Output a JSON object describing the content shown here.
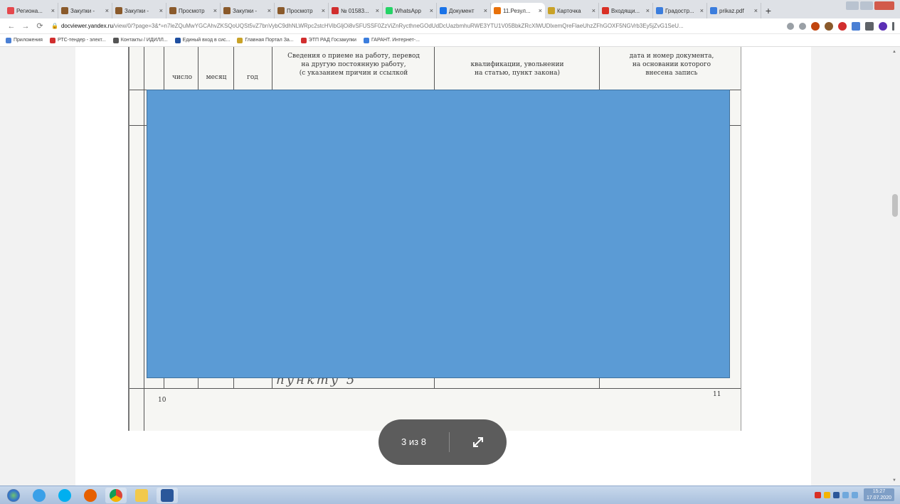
{
  "browser": {
    "tabs": [
      {
        "title": "Региона...",
        "color": "#e5484d"
      },
      {
        "title": "Закупки -",
        "color": "#8a5a2b"
      },
      {
        "title": "Закупки -",
        "color": "#8a5a2b"
      },
      {
        "title": "Просмотр",
        "color": "#8a5a2b"
      },
      {
        "title": "Закупки -",
        "color": "#8a5a2b"
      },
      {
        "title": "Просмотр",
        "color": "#8a5a2b"
      },
      {
        "title": "№ 01583...",
        "color": "#d12e2e"
      },
      {
        "title": "WhatsApp",
        "color": "#25d366"
      },
      {
        "title": "Документ",
        "color": "#1a73e8"
      },
      {
        "title": "11.Резул...",
        "color": "#e8710a"
      },
      {
        "title": "Карточка",
        "color": "#c9a227"
      },
      {
        "title": "Входящи...",
        "color": "#d93025"
      },
      {
        "title": "Градостр...",
        "color": "#3b7ddd"
      },
      {
        "title": "prikaz.pdf",
        "color": "#3b7ddd"
      }
    ],
    "active_tab_index": 9,
    "url_domain": "docviewer.yandex.ru",
    "url_path": "/view/0/?page=3&*=n7leZQuMwYGCAhvZKSQoUQSt5vZ7bnVybC9dhNLWRpc2stcHVibGljOi8vSFUSSF0ZzViZnRycthneGOdUdDcUazbmhuRWE3YTU1V05BbkZRcXlWUDlxemQreFlaeUhzZFhGOXF5NGVrb3Ey5jZvG1SeU...",
    "bookmarks": [
      {
        "label": "Приложения",
        "color": "#4a7fd4"
      },
      {
        "label": "РТС-тендер - элект...",
        "color": "#d12e2e"
      },
      {
        "label": "Контакты / ИДИЛЛ...",
        "color": "#555"
      },
      {
        "label": "Единый вход в сис...",
        "color": "#1f4fa0"
      },
      {
        "label": "Главная Портал За...",
        "color": "#c9a227"
      },
      {
        "label": "ЭТП РАД Госзакупки",
        "color": "#d12e2e"
      },
      {
        "label": "ГАРАНТ. Интернет-...",
        "color": "#3b7ddd"
      }
    ]
  },
  "document": {
    "header_col_date": [
      "число",
      "месяц",
      "год"
    ],
    "header_info": [
      "Сведения о приеме на работу, перевод",
      "на другую постоянную работу,",
      "(с указанием причин и ссылкой"
    ],
    "header_qual": [
      "квалификации, увольнении",
      "на статью, пункт закона)"
    ],
    "header_basis": [
      "дата и номер документа,",
      "на основании которого",
      "внесена запись"
    ],
    "handwriting": "пункту 5",
    "page_left": "10",
    "page_right": "11"
  },
  "viewer": {
    "page_counter": "3 из 8",
    "expand_icon": "expand-arrows-icon"
  },
  "taskbar": {
    "time": "15:27",
    "date": "17.07.2020",
    "apps": [
      "start-orb",
      "internet-explorer",
      "skype",
      "firefox",
      "chrome",
      "file-explorer",
      "word"
    ]
  }
}
